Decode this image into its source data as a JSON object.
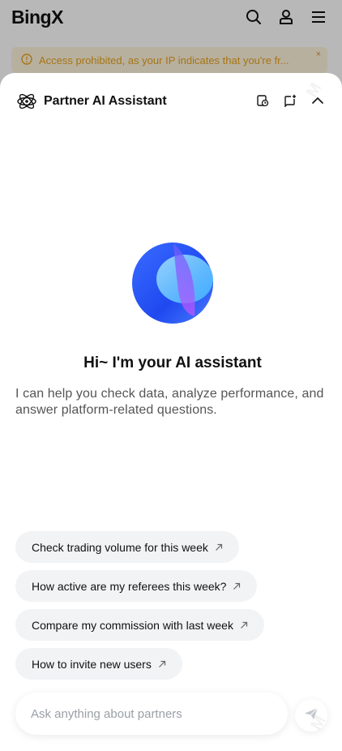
{
  "app": {
    "logo": "BingX"
  },
  "notice": {
    "text": "Access prohibited, as your IP indicates that you're fr...",
    "close": "×"
  },
  "assistant": {
    "title": "Partner AI Assistant",
    "greeting": "Hi~ I'm your AI assistant",
    "description": "I can help you check data, analyze performance, and answer platform-related questions.",
    "suggestions": [
      {
        "label": "Check trading volume for this week"
      },
      {
        "label": "How active are my referees this week?"
      },
      {
        "label": "Compare my commission with last week"
      },
      {
        "label": "How to invite new users"
      }
    ],
    "input_placeholder": "Ask anything about partners",
    "icons": [
      "history-icon",
      "new-chat-icon",
      "chevron-up-icon",
      "send-icon"
    ]
  },
  "colors": {
    "warning_text": "#e6a21b",
    "warning_bg": "#fff4dd",
    "orb_primary": "#2a5bff",
    "orb_secondary": "#5ad0ff",
    "orb_accent": "#b04cff",
    "chip_bg": "#f2f3f5"
  }
}
